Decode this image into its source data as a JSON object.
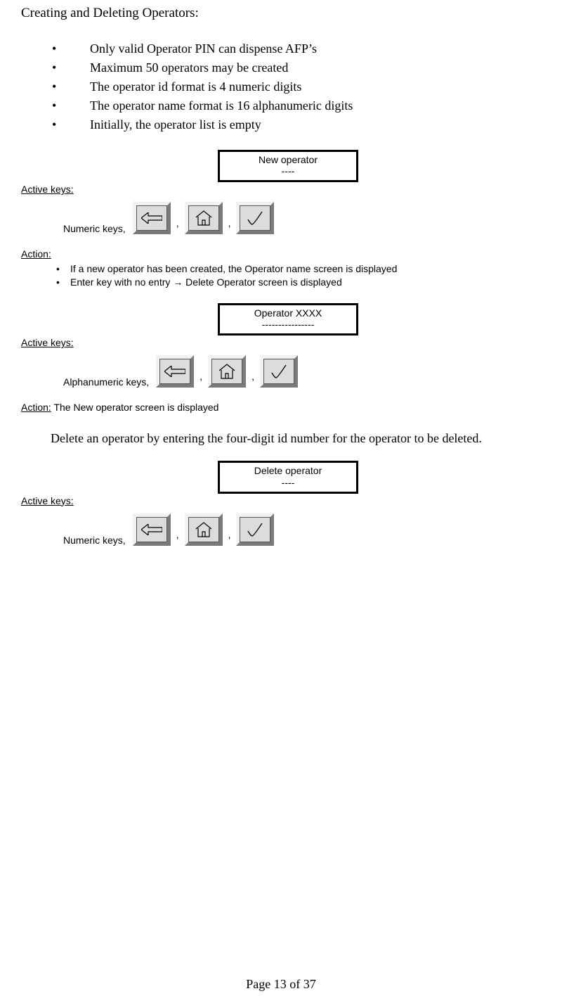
{
  "title": "Creating and Deleting Operators:",
  "main_bullets": [
    "Only valid Operator PIN can dispense AFP’s",
    "Maximum 50 operators may be created",
    "The operator id format is 4 numeric digits",
    "The operator name format is 16 alphanumeric digits",
    "Initially, the operator list is empty"
  ],
  "screens": {
    "new_operator": {
      "line1": "New operator",
      "line2": "----"
    },
    "operator_name": {
      "line1": "Operator XXXX",
      "line2": "----------------"
    },
    "delete_operator": {
      "line1": "Delete operator",
      "line2": "----"
    }
  },
  "labels": {
    "active_keys": "Active keys:",
    "action": "Action:",
    "numeric_keys": "Numeric keys,",
    "alphanumeric_keys": "Alphanumeric keys,",
    "comma": ","
  },
  "actions": {
    "a1_items": [
      "If a new operator has been created, the Operator name screen is displayed",
      "Enter key with no entry → Delete Operator screen is displayed"
    ],
    "a2_text": "The New operator screen is displayed"
  },
  "delete_para": "Delete an operator by entering the four-digit id number for the operator to be deleted.",
  "footer": "Page 13 of 37",
  "icons": {
    "back": "back-arrow-icon",
    "home": "home-icon",
    "check": "check-icon"
  }
}
